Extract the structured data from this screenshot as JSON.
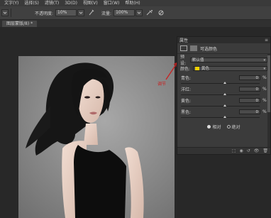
{
  "menubar": {
    "items": [
      {
        "label": "文字(Y)"
      },
      {
        "label": "选择(S)"
      },
      {
        "label": "滤镜(T)"
      },
      {
        "label": "3D(D)"
      },
      {
        "label": "视图(V)"
      },
      {
        "label": "窗口(W)"
      },
      {
        "label": "帮助(H)"
      }
    ]
  },
  "options": {
    "opacity_label": "不透明度:",
    "opacity_value": "10%",
    "flow_label": "流量:",
    "flow_value": "100%"
  },
  "document_tab": {
    "label": "图层蒙版/8) *"
  },
  "annotation": {
    "text": "调节",
    "color": "#c82020"
  },
  "properties_panel": {
    "title": "属性",
    "menu": "≡",
    "subtitle": "可选颜色",
    "preset_label": "预设:",
    "preset_value": "默认值",
    "color_label": "颜色:",
    "color_value": "黄色",
    "color_swatch": "#f0d000",
    "sliders": [
      {
        "label": "青色:",
        "value": "0",
        "unit": "%"
      },
      {
        "label": "洋红:",
        "value": "0",
        "unit": "%"
      },
      {
        "label": "黄色:",
        "value": "0",
        "unit": "%"
      },
      {
        "label": "黑色:",
        "value": "0",
        "unit": "%"
      }
    ],
    "method_relative": "相对",
    "method_absolute": "绝对",
    "method_selected": "相对"
  }
}
